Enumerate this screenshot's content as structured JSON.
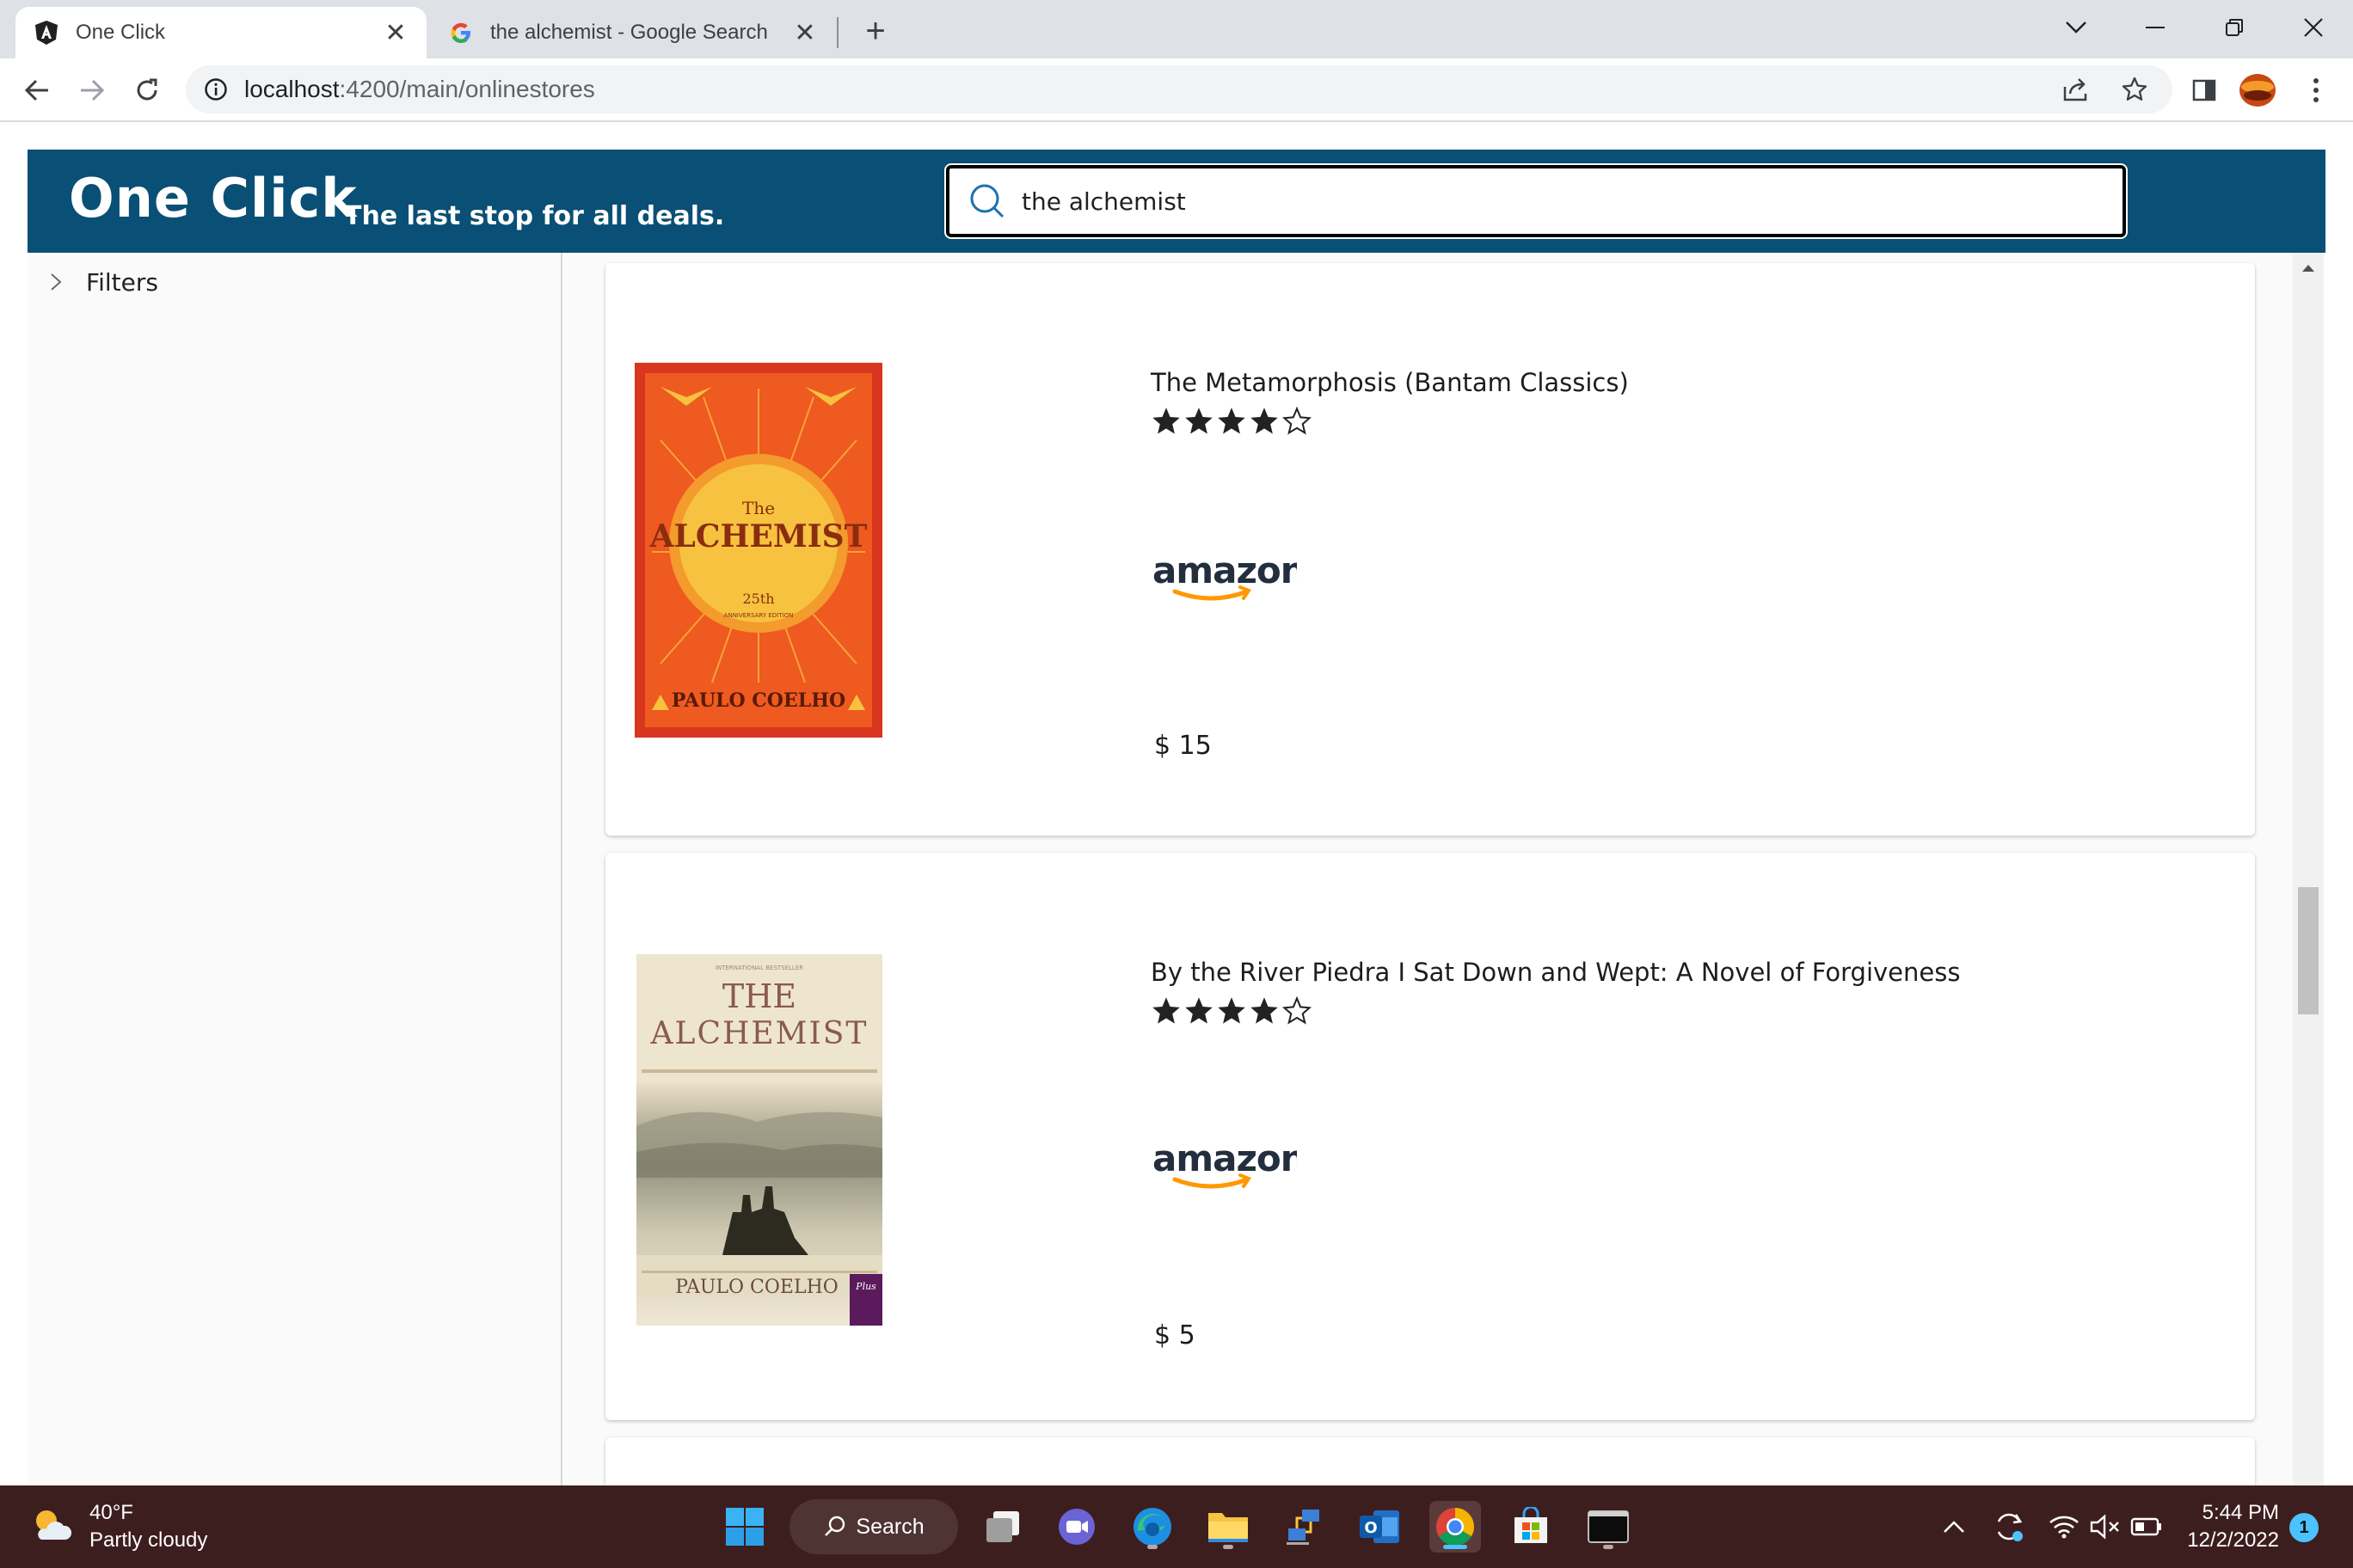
{
  "browser": {
    "tabs": [
      {
        "title": "One Click",
        "favicon": "angular-icon",
        "active": true
      },
      {
        "title": "the alchemist - Google Search",
        "favicon": "google-icon",
        "active": false
      }
    ],
    "url_host": "localhost",
    "url_path": ":4200/main/onlinestores"
  },
  "app": {
    "brand": "One Click",
    "tagline": "The last stop for all deals.",
    "search": {
      "value": "the alchemist",
      "placeholder": ""
    },
    "colors": {
      "header": "#0a4f75",
      "text": "#1d1d1d"
    }
  },
  "sidebar": {
    "filters_label": "Filters"
  },
  "results": [
    {
      "title": "The Metamorphosis (Bantam Classics)",
      "rating": 4,
      "rating_max": 5,
      "store": "amazon",
      "price": "$ 15",
      "cover": {
        "title": "The ALCHEMIST",
        "edition": "25th ANNIVERSARY EDITION",
        "author": "PAULO COELHO"
      }
    },
    {
      "title": "By the River Piedra I Sat Down and Wept: A Novel of Forgiveness",
      "rating": 4,
      "rating_max": 5,
      "store": "amazon",
      "price": "$ 5",
      "cover": {
        "title_line1": "THE",
        "title_line2": "ALCHEMIST",
        "author": "PAULO COELHO"
      }
    }
  ],
  "taskbar": {
    "weather_temp": "40°F",
    "weather_desc": "Partly cloudy",
    "search_label": "Search",
    "time": "5:44 PM",
    "date": "12/2/2022",
    "notifications": "1"
  }
}
